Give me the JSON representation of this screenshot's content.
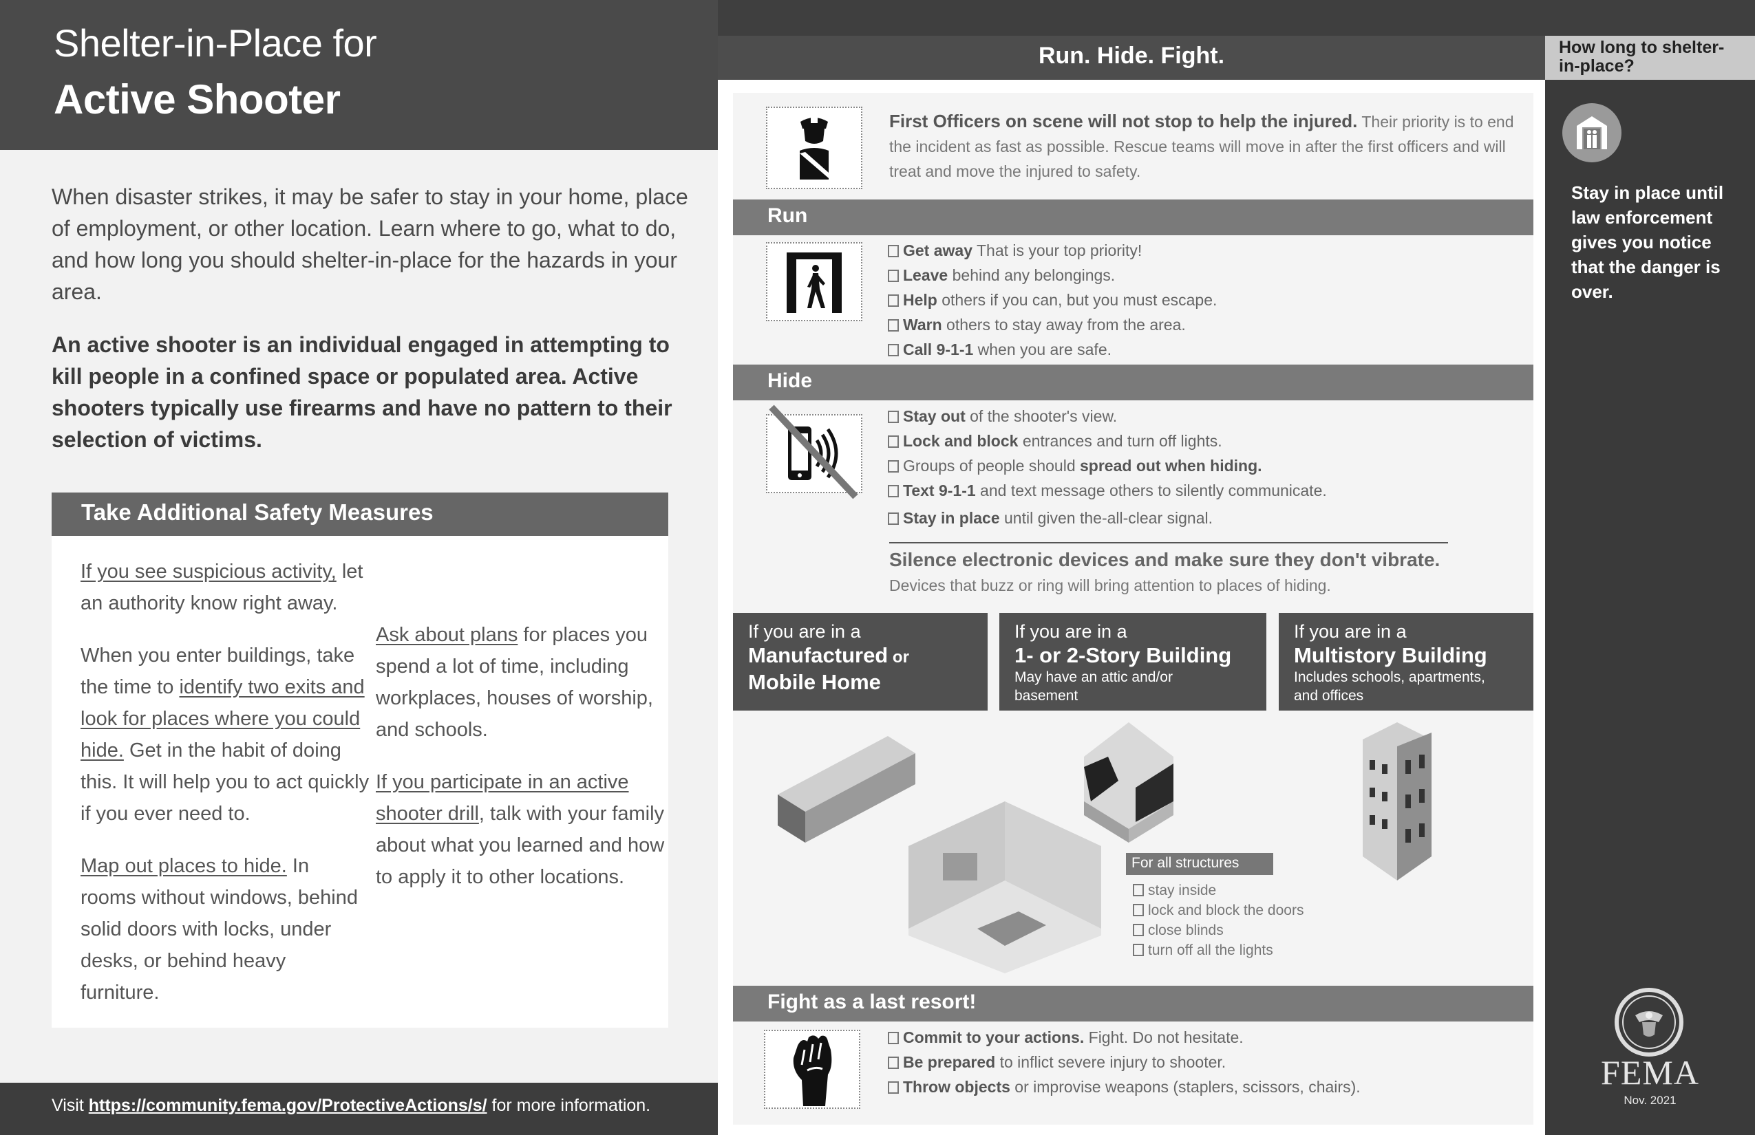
{
  "header": {
    "title_line1": "Shelter-in-Place for",
    "title_line2": "Active Shooter"
  },
  "intro": {
    "paragraph": "When disaster strikes, it may be safer to stay in your home, place of employment, or other location. Learn where to go, what to do, and how long you should shelter-in-place for the hazards in your area.",
    "definition": "An active shooter is an individual engaged in attempting to kill people in a confined space or populated area. Active shooters typically use firearms and have no pattern to their selection of victims."
  },
  "safety_measures": {
    "title": "Take Additional Safety Measures",
    "items": [
      {
        "link": "If you see suspicious activity,",
        "text": " let an authority know right away."
      },
      {
        "pre": "When you enter buildings, take the time to ",
        "link": "identify two exits and look for places where you could hide.",
        "text": " Get in the habit of doing this. It will help you to act quickly if you ever need to."
      },
      {
        "link": "Map out places to hide.",
        "text": " In rooms without windows, behind solid doors with locks, under desks, or behind heavy furniture."
      },
      {
        "link": "Ask about plans",
        "text": " for places you spend a lot of time, including workplaces, houses of worship, and schools."
      },
      {
        "link": "If you participate in an active shooter drill",
        "text": ", talk with your family about what you learned and how to apply it to other locations."
      }
    ]
  },
  "footer": {
    "prefix": "Visit ",
    "url": "https://community.fema.gov/ProtectiveActions/s/",
    "suffix": " for more information."
  },
  "run_hide_fight": {
    "title": "Run. Hide. Fight.",
    "officers": {
      "bold": "First Officers on scene will not stop to help the injured.",
      "text": " Their priority is to end the incident as fast as possible. Rescue teams will move in after the first officers and will treat and move the injured to safety."
    },
    "run": {
      "label": "Run",
      "items": [
        {
          "bold": "Get away",
          "text": " That is your top priority!"
        },
        {
          "bold": "Leave",
          "text": " behind any belongings."
        },
        {
          "bold": "Help",
          "text": " others if you can, but you must escape."
        },
        {
          "bold": "Warn",
          "text": " others to stay away from the area."
        },
        {
          "bold": "Call 9-1-1",
          "text": " when you are safe."
        }
      ]
    },
    "hide": {
      "label": "Hide",
      "items": [
        {
          "bold": "Stay out",
          "text": " of the shooter's view."
        },
        {
          "bold": "Lock and block",
          "text": " entrances and turn off lights."
        },
        {
          "pre": "Groups of people should ",
          "bold": "spread out when hiding.",
          "text": ""
        },
        {
          "bold": "Text 9-1-1",
          "text": " and text message others to silently communicate."
        },
        {
          "bold": "Stay in place",
          "text": " until given the-all-clear signal."
        }
      ],
      "silence_title": "Silence electronic devices and make sure they don't vibrate.",
      "silence_sub": "Devices that buzz or ring will bring attention to places of hiding."
    },
    "building_cards": [
      {
        "pre": "If you are in a",
        "main": "Manufactured",
        "main_suffix": " or",
        "main2": "Mobile Home",
        "sub": ""
      },
      {
        "pre": "If you are in a",
        "main": "1- or 2-Story Building",
        "main_suffix": "",
        "main2": "",
        "sub": "May have an attic and/or basement"
      },
      {
        "pre": "If you are in a",
        "main": "Multistory Building",
        "main_suffix": "",
        "main2": "",
        "sub": "Includes schools, apartments, and offices"
      }
    ],
    "all_structures": {
      "label": "For all structures",
      "items": [
        "stay inside",
        "lock and block the doors",
        "close blinds",
        "turn off all the lights"
      ]
    },
    "fight": {
      "label": "Fight as a last resort!",
      "items": [
        {
          "bold": "Commit to your actions.",
          "text": " Fight. Do not hesitate."
        },
        {
          "bold": "Be prepared",
          "text": " to inflict severe injury to shooter."
        },
        {
          "bold": "Throw objects",
          "text": " or improvise weapons (staplers, scissors, chairs)."
        }
      ]
    }
  },
  "sidebar": {
    "label": "How long to shelter-in-place?",
    "text": "Stay in place until law enforcement gives you notice that the danger is over.",
    "icon": "shelter-icon"
  },
  "branding": {
    "agency": "FEMA",
    "seal": "dhs-seal-icon",
    "date": "Nov. 2021"
  }
}
